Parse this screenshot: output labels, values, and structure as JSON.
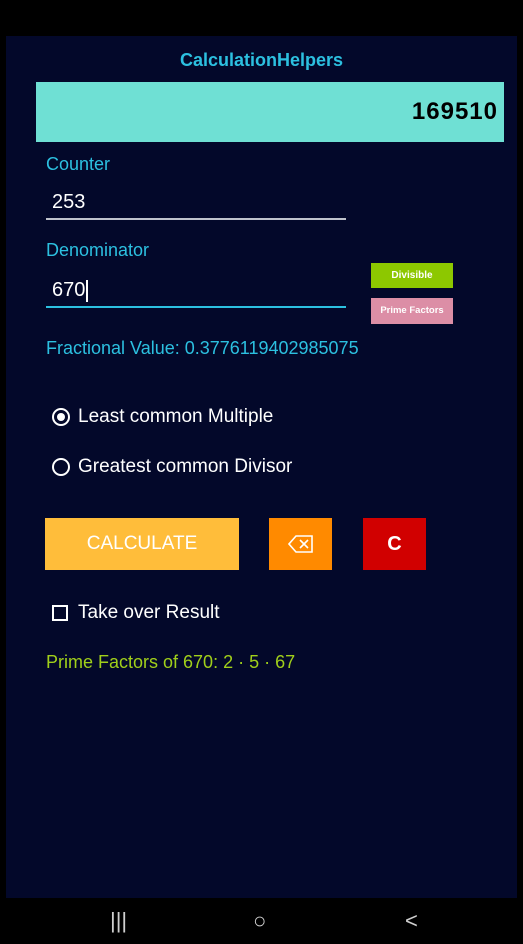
{
  "app": {
    "title": "CalculationHelpers",
    "result_display": "169510"
  },
  "counter": {
    "label": "Counter",
    "value": "253"
  },
  "denominator": {
    "label": "Denominator",
    "value": "670"
  },
  "buttons": {
    "divisible": "Divisible",
    "prime_factors": "Prime Factors",
    "calculate": "CALCULATE",
    "backspace_icon": "backspace-icon",
    "clear": "C"
  },
  "fractional_value": "Fractional Value: 0.3776119402985075",
  "options": {
    "lcm_label": "Least common Multiple",
    "gcd_label": "Greatest common Divisor",
    "selected": "lcm"
  },
  "take_over": {
    "label": "Take over Result",
    "checked": false
  },
  "prime_factors_text": "Prime Factors of 670: 2 · 5 · 67",
  "nav": {
    "recents": "|||",
    "home": "○",
    "back": "<"
  },
  "colors": {
    "background": "#03082a",
    "accent": "#2cc0e0",
    "result_bg": "#6fe0d4",
    "divisible_btn": "#8dc800",
    "prime_factors_btn": "#dc8ea6",
    "calculate_btn": "#ffbd3a",
    "backspace_btn": "#ff8a00",
    "clear_btn": "#d10000",
    "primes_text": "#a0cf1a"
  }
}
